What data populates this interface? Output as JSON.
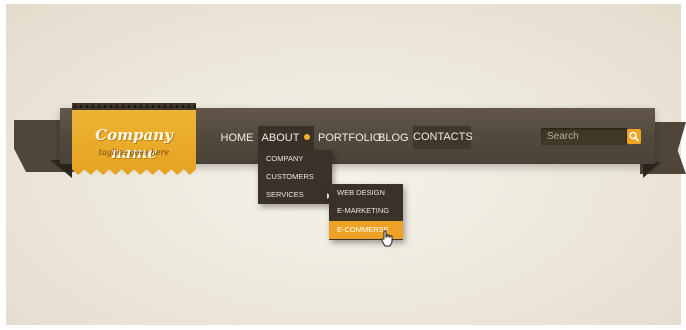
{
  "brand": {
    "name": "Company name",
    "tagline": "tagline goes here"
  },
  "nav": {
    "items": [
      {
        "label": "HOME"
      },
      {
        "label": "ABOUT"
      },
      {
        "label": "PORTFOLIO"
      },
      {
        "label": "BLOG"
      },
      {
        "label": "CONTACTS"
      }
    ]
  },
  "search": {
    "placeholder": "Search"
  },
  "about_menu": {
    "items": [
      {
        "label": "COMPANY"
      },
      {
        "label": "CUSTOMERS"
      },
      {
        "label": "SERVICES"
      }
    ]
  },
  "services_menu": {
    "items": [
      {
        "label": "WEB DESIGN"
      },
      {
        "label": "E-MARKETING"
      },
      {
        "label": "E-COMMERSE"
      }
    ],
    "active_index": 2
  },
  "colors": {
    "accent": "#f0a31f",
    "bar": "#534a3e",
    "dropdown": "#3a3128",
    "background": "#ece7da"
  },
  "icons": [
    "search-icon",
    "pointer-cursor-icon",
    "submenu-arrow-icon"
  ]
}
